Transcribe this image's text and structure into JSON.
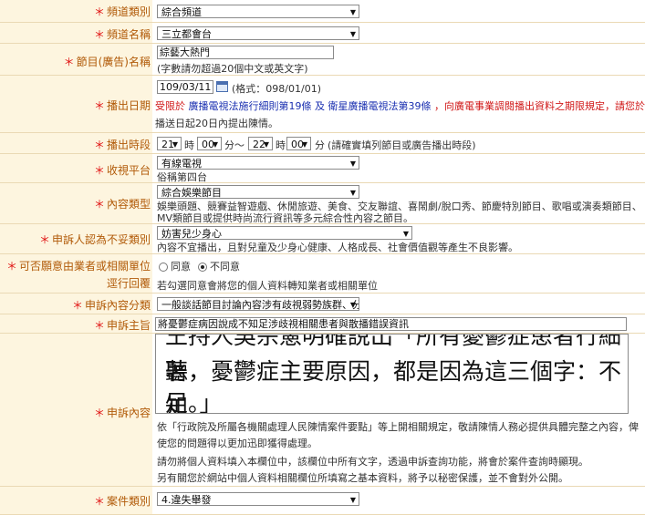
{
  "rows": {
    "channel_category": {
      "star": "＊",
      "label": "頻道類別",
      "value": "綜合頻道"
    },
    "channel_name": {
      "star": "＊",
      "label": "頻道名稱",
      "value": "三立都會台"
    },
    "program_name": {
      "star": "＊",
      "label": "節目(廣告)名稱",
      "value": "綜藝大熱門",
      "hint": "(字數請勿超過20個中文或英文字)"
    },
    "broadcast_date": {
      "star": "＊",
      "label": "播出日期",
      "value": "109/03/11",
      "format": "(格式：098/01/01)",
      "note_pre": "受限於",
      "link1": "廣播電視法施行細則第19條",
      "and": "及",
      "link2": "衛星廣播電視法第39條",
      "note_post": "，向廣電事業調閱播出資料之期限規定，請您於",
      "note_line2": "播送日起20日內提出陳情。"
    },
    "broadcast_time": {
      "star": "＊",
      "label": "播出時段",
      "h1": "21",
      "hour1": "時",
      "m1": "00",
      "min1": "分",
      "tilde": "～",
      "h2": "22",
      "hour2": "時",
      "m2": "00",
      "min2": "分",
      "note": "(請確實填列節目或廣告播出時段)"
    },
    "platform": {
      "star": "＊",
      "label": "收視平台",
      "value": "有線電視",
      "sub": "俗稱第四台"
    },
    "content_type": {
      "star": "＊",
      "label": "內容類型",
      "value": "綜合娛樂節目",
      "desc1": "娛樂頭題、競賽益智遊戲、休閒旅遊、美食、交友聯誼、喜鬧劇/脫口秀、節慶特別節目、歌唱或演奏類節目、",
      "desc2": "MV類節目或提供時尚流行資訊等多元綜合性內容之節目。"
    },
    "inappropriate": {
      "star": "＊",
      "label": "申訴人認為不妥類別",
      "value": "妨害兒少身心",
      "desc": "內容不宜播出，且對兒童及少身心健康、人格成長、社會價值觀等產生不良影響。"
    },
    "consent": {
      "star": "＊",
      "label": "可否願意由業者或相關單位",
      "label2": "逕行回覆",
      "opt1": "同意",
      "opt2": "不同意",
      "note": "若勾選同意會將您的個人資料轉知業者或相關單位"
    },
    "complaint_category": {
      "star": "＊",
      "label": "申訴內容分類",
      "value": "一般談話節目討論內容涉有歧視弱勢族群、分化"
    },
    "complaint_subject": {
      "star": "＊",
      "label": "申訴主旨",
      "value": "將憂鬱症病因說成不知足涉歧視相關患者與散播錯誤資訊"
    },
    "complaint_content": {
      "star": "＊",
      "label": "申訴內容",
      "line1": "王持人吳宗憲明確說出「所有憂鬱症患者行細聽",
      "line2": "著，憂鬱症主要原因，都是因為這三個字：不知",
      "line3": "足。」",
      "n1": "依「行政院及所屬各機關處理人民陳情案件要點」等上開相關規定，敬請陳情人務必提供具體完整之內容，俾",
      "n2": "使您的問題得以更加迅即獲得處理。",
      "n3": "請勿將個人資料填入本欄位中，該欄位中所有文字，透過申訴查詢功能，將會於案件查詢時顯現。",
      "n4": "另有關您於網站中個人資料相關欄位所填寫之基本資料，將予以秘密保護，並不會對外公開。"
    },
    "case_category": {
      "star": "＊",
      "label": "案件類別",
      "value": "4.違失舉發"
    }
  }
}
